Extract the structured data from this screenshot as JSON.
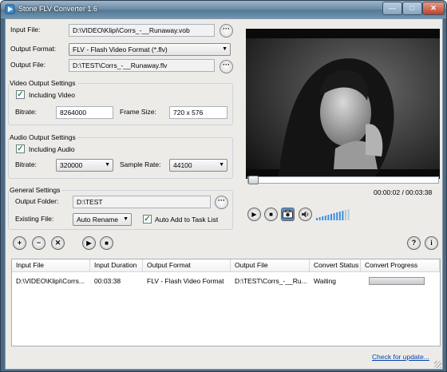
{
  "window": {
    "title": "Stone FLV Converter 1.6",
    "caption_buttons": {
      "minimize": "—",
      "maximize": "□",
      "close": "✕"
    }
  },
  "input": {
    "input_file_label": "Input File:",
    "input_file_value": "D:\\VIDEO\\Klipi\\Corrs_-__Runaway.vob",
    "output_format_label": "Output Format:",
    "output_format_value": "FLV - Flash Video Format (*.flv)",
    "output_file_label": "Output File:",
    "output_file_value": "D:\\TEST\\Corrs_-__Runaway.flv",
    "browse_label": "···"
  },
  "video_settings": {
    "title": "Video Output Settings",
    "including_video_label": "Including Video",
    "including_video_checked": true,
    "bitrate_label": "Bitrate:",
    "bitrate_value": "8264000",
    "frame_size_label": "Frame Size:",
    "frame_size_value": "720 x 576"
  },
  "audio_settings": {
    "title": "Audio Output Settings",
    "including_audio_label": "Including Audio",
    "including_audio_checked": true,
    "bitrate_label": "Bitrate:",
    "bitrate_value": "320000",
    "sample_rate_label": "Sample Rate:",
    "sample_rate_value": "44100"
  },
  "general_settings": {
    "title": "General Settings",
    "output_folder_label": "Output Folder:",
    "output_folder_value": "D:\\TEST",
    "existing_file_label": "Existing File:",
    "existing_file_value": "Auto Rename",
    "auto_add_label": "Auto Add to Task List",
    "auto_add_checked": true
  },
  "player": {
    "time_display": "00:00:02 / 00:03:38",
    "progress_fraction": 0.01,
    "volume_level": 0.8,
    "controls": {
      "play": "▶",
      "stop": "■"
    }
  },
  "toolbar": {
    "add": "+",
    "remove": "−",
    "clear": "✕",
    "start": "▶",
    "stop": "■",
    "help": "?",
    "info": "i"
  },
  "tasklist": {
    "columns": [
      "Input File",
      "Input Duration",
      "Output Format",
      "Output File",
      "Convert Status",
      "Convert Progress"
    ],
    "rows": [
      {
        "input_file": "D:\\VIDEO\\Klipi\\Corrs...",
        "duration": "00:03:38",
        "format": "FLV - Flash Video Format",
        "output_file": "D:\\TEST\\Corrs_-__Ru...",
        "status": "Waiting",
        "progress": 0
      }
    ]
  },
  "footer": {
    "update_link": "Check for update..."
  },
  "colors": {
    "accent_green": "#6ac35c",
    "link": "#0645ad",
    "titlebar": "#6f8ea8"
  }
}
